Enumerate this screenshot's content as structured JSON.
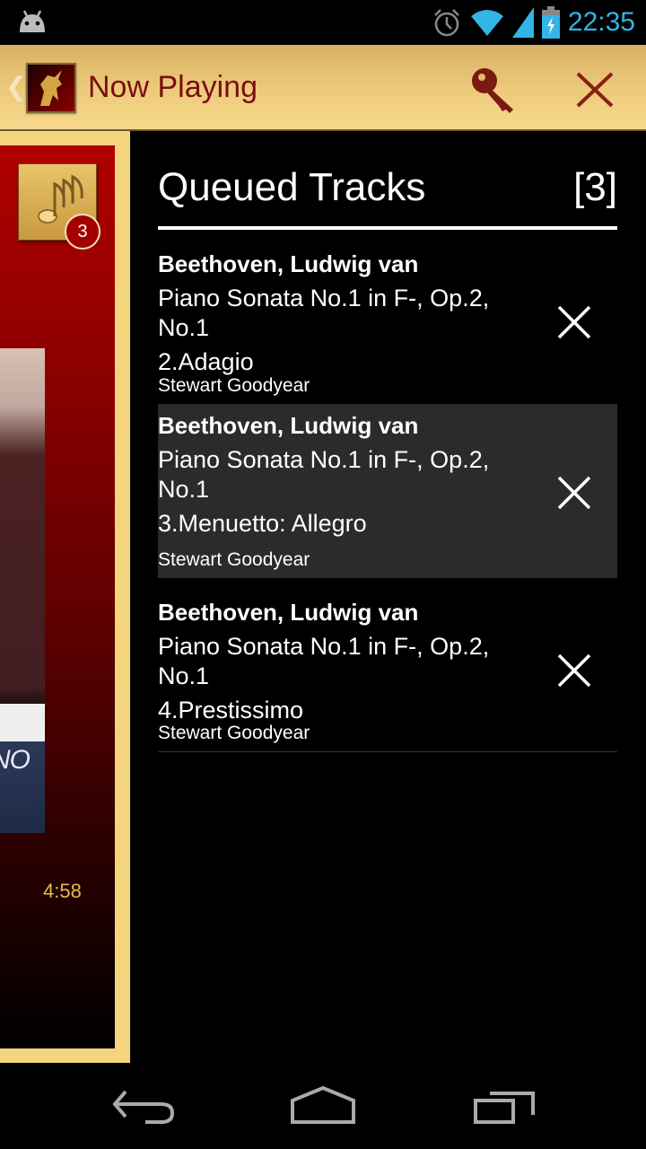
{
  "status_bar": {
    "time": "22:35",
    "icons": [
      "android-icon",
      "alarm-icon",
      "wifi-icon",
      "signal-icon",
      "battery-charging-icon"
    ]
  },
  "action_bar": {
    "up_icon": "chevron-left-icon",
    "logo_icon": "unicorn-logo-icon",
    "title": "Now Playing",
    "key_icon": "key-icon",
    "close_icon": "close-icon"
  },
  "now_playing": {
    "queue_badge_count": "3",
    "album_cover_text": "NO",
    "track_time": "4:58"
  },
  "queue": {
    "title": "Queued Tracks",
    "count_label": "[3]",
    "tracks": [
      {
        "composer": "Beethoven, Ludwig van",
        "work": "Piano Sonata No.1 in F-, Op.2, No.1",
        "movement": "2.Adagio",
        "artist": "Stewart Goodyear",
        "selected": false
      },
      {
        "composer": "Beethoven, Ludwig van",
        "work": "Piano Sonata No.1 in F-, Op.2, No.1",
        "movement": "3.Menuetto: Allegro",
        "artist": "Stewart Goodyear",
        "selected": true
      },
      {
        "composer": "Beethoven, Ludwig van",
        "work": "Piano Sonata No.1 in F-, Op.2, No.1",
        "movement": "4.Prestissimo",
        "artist": "Stewart Goodyear",
        "selected": false
      }
    ]
  },
  "nav_bar": {
    "buttons": [
      "back-icon",
      "home-icon",
      "recent-apps-icon"
    ]
  },
  "colors": {
    "accent_blue": "#33b5e5",
    "title_red": "#7a0f0f",
    "gold": "#f5d47e",
    "time_gold": "#e8b94a",
    "selected_row": "#2b2b2b"
  }
}
